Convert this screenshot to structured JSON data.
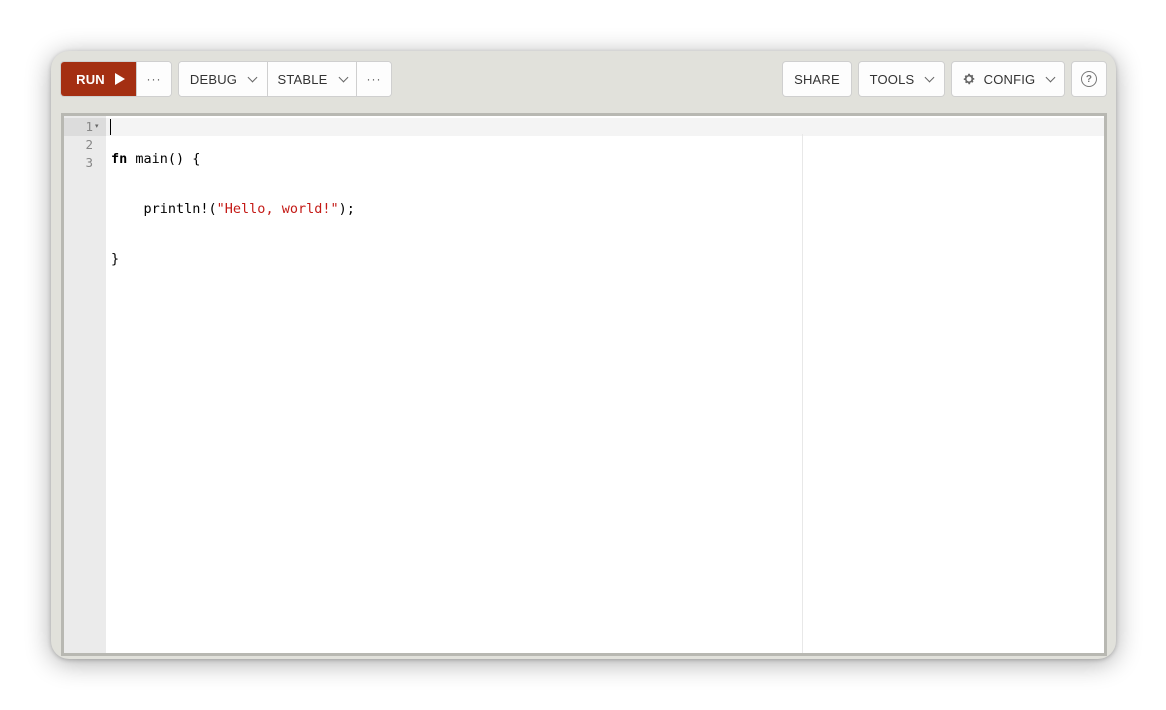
{
  "toolbar": {
    "run_label": "RUN",
    "run_more": "···",
    "mode_label": "DEBUG",
    "channel_label": "STABLE",
    "channel_more": "···",
    "share_label": "SHARE",
    "tools_label": "TOOLS",
    "config_label": "CONFIG",
    "help_glyph": "?"
  },
  "editor": {
    "line_numbers": [
      "1",
      "2",
      "3"
    ],
    "lines": [
      {
        "kw": "fn",
        "rest": " main() {"
      },
      {
        "indent": "    ",
        "macro": "println!(",
        "string": "\"Hello, world!\"",
        "tail": ");"
      },
      {
        "text": "}"
      }
    ]
  },
  "colors": {
    "run_button": "#a42f12",
    "string": "#c41a16",
    "frame_bg": "#e1e1db"
  },
  "icons": [
    "play-icon",
    "more-dots-icon",
    "chevron-down-icon",
    "gear-icon",
    "help-icon",
    "fold-arrow-icon"
  ]
}
